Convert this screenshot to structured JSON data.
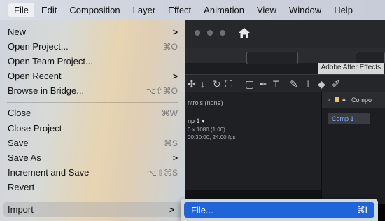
{
  "menubar": {
    "items": [
      "File",
      "Edit",
      "Composition",
      "Layer",
      "Effect",
      "Animation",
      "View",
      "Window",
      "Help"
    ]
  },
  "file_menu": {
    "items": [
      {
        "label": "New",
        "shortcut": "",
        "submenu": true
      },
      {
        "label": "Open Project...",
        "shortcut": "⌘O",
        "submenu": false
      },
      {
        "label": "Open Team Project...",
        "shortcut": "",
        "submenu": false
      },
      {
        "label": "Open Recent",
        "shortcut": "",
        "submenu": true
      },
      {
        "label": "Browse in Bridge...",
        "shortcut": "⌥⇧⌘O",
        "submenu": false
      },
      {
        "label": "Close",
        "shortcut": "⌘W",
        "submenu": false
      },
      {
        "label": "Close Project",
        "shortcut": "",
        "submenu": false
      },
      {
        "label": "Save",
        "shortcut": "⌘S",
        "submenu": false
      },
      {
        "label": "Save As",
        "shortcut": "",
        "submenu": true
      },
      {
        "label": "Increment and Save",
        "shortcut": "⌥⇧⌘S",
        "submenu": false
      },
      {
        "label": "Revert",
        "shortcut": "",
        "submenu": false
      },
      {
        "label": "Import",
        "shortcut": "",
        "submenu": true
      }
    ]
  },
  "import_submenu": {
    "item_label": "File...",
    "item_shortcut": "⌘I"
  },
  "app": {
    "title": "Adobe After Effects",
    "effect_controls": "ntrols (none)",
    "comp_name": "np 1 ▾",
    "comp_resolution": "0 x 1080 (1.00)",
    "comp_duration": "00:30:00, 24.00 fps",
    "tab_label": "Compo",
    "comp_chip": "Comp 1"
  },
  "colors": {
    "highlight": "#1f64d8",
    "ae_bg": "#1c1d21"
  }
}
